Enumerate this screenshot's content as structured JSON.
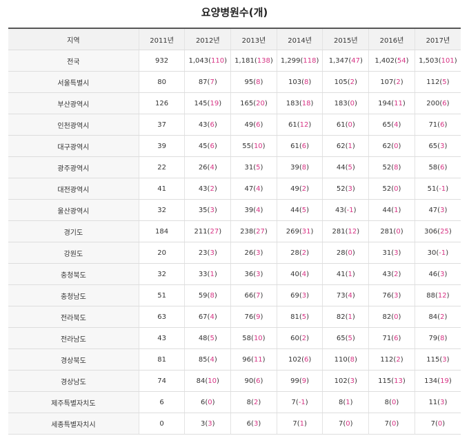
{
  "title": "요양병원수(개)",
  "accent_color": "#d63384",
  "header": [
    "지역",
    "2011년",
    "2012년",
    "2013년",
    "2014년",
    "2015년",
    "2016년",
    "2017년"
  ],
  "rows": [
    {
      "region": "전국",
      "y2011": "932",
      "cells": [
        [
          "1,043",
          "110"
        ],
        [
          "1,181",
          "138"
        ],
        [
          "1,299",
          "118"
        ],
        [
          "1,347",
          "47"
        ],
        [
          "1,402",
          "54"
        ],
        [
          "1,503",
          "101"
        ]
      ]
    },
    {
      "region": "서울특별시",
      "y2011": "80",
      "cells": [
        [
          "87",
          "7"
        ],
        [
          "95",
          "8"
        ],
        [
          "103",
          "8"
        ],
        [
          "105",
          "2"
        ],
        [
          "107",
          "2"
        ],
        [
          "112",
          "5"
        ]
      ]
    },
    {
      "region": "부산광역시",
      "y2011": "126",
      "cells": [
        [
          "145",
          "19"
        ],
        [
          "165",
          "20"
        ],
        [
          "183",
          "18"
        ],
        [
          "183",
          "0"
        ],
        [
          "194",
          "11"
        ],
        [
          "200",
          "6"
        ]
      ]
    },
    {
      "region": "인천광역시",
      "y2011": "37",
      "cells": [
        [
          "43",
          "6"
        ],
        [
          "49",
          "6"
        ],
        [
          "61",
          "12"
        ],
        [
          "61",
          "0"
        ],
        [
          "65",
          "4"
        ],
        [
          "71",
          "6"
        ]
      ]
    },
    {
      "region": "대구광역시",
      "y2011": "39",
      "cells": [
        [
          "45",
          "6"
        ],
        [
          "55",
          "10"
        ],
        [
          "61",
          "6"
        ],
        [
          "62",
          "1"
        ],
        [
          "62",
          "0"
        ],
        [
          "65",
          "3"
        ]
      ]
    },
    {
      "region": "광주광역시",
      "y2011": "22",
      "cells": [
        [
          "26",
          "4"
        ],
        [
          "31",
          "5"
        ],
        [
          "39",
          "8"
        ],
        [
          "44",
          "5"
        ],
        [
          "52",
          "8"
        ],
        [
          "58",
          "6"
        ]
      ]
    },
    {
      "region": "대전광역시",
      "y2011": "41",
      "cells": [
        [
          "43",
          "2"
        ],
        [
          "47",
          "4"
        ],
        [
          "49",
          "2"
        ],
        [
          "52",
          "3"
        ],
        [
          "52",
          "0"
        ],
        [
          "51",
          "-1"
        ]
      ]
    },
    {
      "region": "울산광역시",
      "y2011": "32",
      "cells": [
        [
          "35",
          "3"
        ],
        [
          "39",
          "4"
        ],
        [
          "44",
          "5"
        ],
        [
          "43",
          "-1"
        ],
        [
          "44",
          "1"
        ],
        [
          "47",
          "3"
        ]
      ]
    },
    {
      "region": "경기도",
      "y2011": "184",
      "cells": [
        [
          "211",
          "27"
        ],
        [
          "238",
          "27"
        ],
        [
          "269",
          "31"
        ],
        [
          "281",
          "12"
        ],
        [
          "281",
          "0"
        ],
        [
          "306",
          "25"
        ]
      ]
    },
    {
      "region": "강원도",
      "y2011": "20",
      "cells": [
        [
          "23",
          "3"
        ],
        [
          "26",
          "3"
        ],
        [
          "28",
          "2"
        ],
        [
          "28",
          "0"
        ],
        [
          "31",
          "3"
        ],
        [
          "30",
          "-1"
        ]
      ]
    },
    {
      "region": "충청북도",
      "y2011": "32",
      "cells": [
        [
          "33",
          "1"
        ],
        [
          "36",
          "3"
        ],
        [
          "40",
          "4"
        ],
        [
          "41",
          "1"
        ],
        [
          "43",
          "2"
        ],
        [
          "46",
          "3"
        ]
      ]
    },
    {
      "region": "충청남도",
      "y2011": "51",
      "cells": [
        [
          "59",
          "8"
        ],
        [
          "66",
          "7"
        ],
        [
          "69",
          "3"
        ],
        [
          "73",
          "4"
        ],
        [
          "76",
          "3"
        ],
        [
          "88",
          "12"
        ]
      ]
    },
    {
      "region": "전라북도",
      "y2011": "63",
      "cells": [
        [
          "67",
          "4"
        ],
        [
          "76",
          "9"
        ],
        [
          "81",
          "5"
        ],
        [
          "82",
          "1"
        ],
        [
          "82",
          "0"
        ],
        [
          "84",
          "2"
        ]
      ]
    },
    {
      "region": "전라남도",
      "y2011": "43",
      "cells": [
        [
          "48",
          "5"
        ],
        [
          "58",
          "10"
        ],
        [
          "60",
          "2"
        ],
        [
          "65",
          "5"
        ],
        [
          "71",
          "6"
        ],
        [
          "79",
          "8"
        ]
      ]
    },
    {
      "region": "경상북도",
      "y2011": "81",
      "cells": [
        [
          "85",
          "4"
        ],
        [
          "96",
          "11"
        ],
        [
          "102",
          "6"
        ],
        [
          "110",
          "8"
        ],
        [
          "112",
          "2"
        ],
        [
          "115",
          "3"
        ]
      ]
    },
    {
      "region": "경상남도",
      "y2011": "74",
      "cells": [
        [
          "84",
          "10"
        ],
        [
          "90",
          "6"
        ],
        [
          "99",
          "9"
        ],
        [
          "102",
          "3"
        ],
        [
          "115",
          "13"
        ],
        [
          "134",
          "19"
        ]
      ]
    },
    {
      "region": "제주특별자치도",
      "y2011": "6",
      "cells": [
        [
          "6",
          "0"
        ],
        [
          "8",
          "2"
        ],
        [
          "7",
          "-1"
        ],
        [
          "8",
          "1"
        ],
        [
          "8",
          "0"
        ],
        [
          "11",
          "3"
        ]
      ]
    },
    {
      "region": "세종특별자치시",
      "y2011": "0",
      "cells": [
        [
          "3",
          "3"
        ],
        [
          "6",
          "3"
        ],
        [
          "7",
          "1"
        ],
        [
          "7",
          "0"
        ],
        [
          "7",
          "0"
        ],
        [
          "7",
          "0"
        ]
      ]
    }
  ]
}
